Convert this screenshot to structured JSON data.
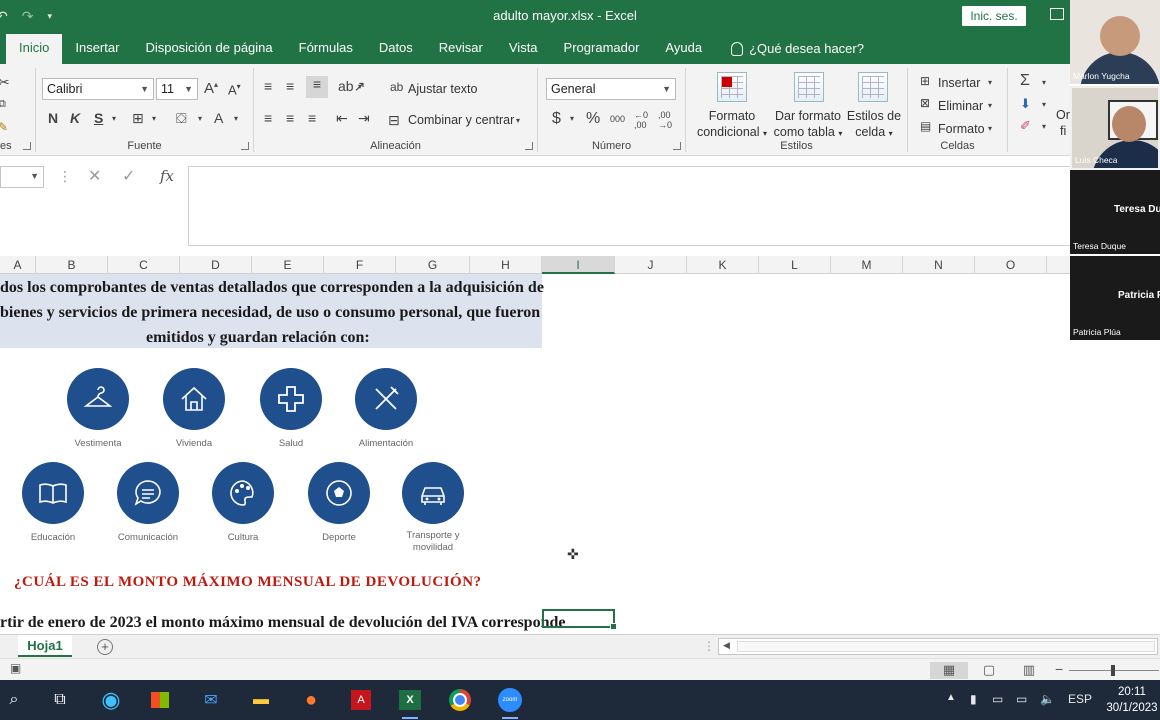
{
  "window": {
    "title": "adulto mayor.xlsx  -  Excel",
    "signin": "Inic. ses."
  },
  "tabs": [
    {
      "label": "Inicio",
      "active": true
    },
    {
      "label": "Insertar"
    },
    {
      "label": "Disposición de página"
    },
    {
      "label": "Fórmulas"
    },
    {
      "label": "Datos"
    },
    {
      "label": "Revisar"
    },
    {
      "label": "Vista"
    },
    {
      "label": "Programador"
    },
    {
      "label": "Ayuda"
    }
  ],
  "tellme": "¿Qué desea hacer?",
  "ribbon": {
    "font": {
      "name": "Calibri",
      "size": "11",
      "bold": "N",
      "italic": "K",
      "underline": "S",
      "group": "Fuente"
    },
    "alignment": {
      "wrap": "Ajustar texto",
      "merge": "Combinar y centrar",
      "group": "Alineación"
    },
    "number": {
      "format": "General",
      "currency": "$",
      "percent": "%",
      "thousands": "000",
      "inc_dec": ",0 ,00",
      "group": "Número"
    },
    "styles": {
      "conditional": [
        "Formato",
        "condicional"
      ],
      "table": [
        "Dar formato",
        "como tabla"
      ],
      "cell": [
        "Estilos de",
        "celda"
      ],
      "group": "Estilos"
    },
    "cells": {
      "insert": "Insertar",
      "delete": "Eliminar",
      "format": "Formato",
      "group": "Celdas"
    },
    "editing": {
      "sigma": "Σ",
      "sort_cut": "Or",
      "find_cut": "fi"
    },
    "left_cut": "es"
  },
  "formula_bar": {
    "fx": "fx",
    "cancel": "✕",
    "enter": "✓"
  },
  "columns": [
    "A",
    "B",
    "C",
    "D",
    "E",
    "F",
    "G",
    "H",
    "I",
    "J",
    "K",
    "L",
    "M",
    "N",
    "O"
  ],
  "selected_column": "I",
  "sheet": {
    "lines": [
      "dos los comprobantes de ventas detallados que corresponden a la adquisición de",
      "bienes y servicios de primera necesidad, de uso o consumo personal, que fueron",
      "emitidos y guardan relación con:"
    ],
    "categories_row1": [
      "Vestimenta",
      "Vivienda",
      "Salud",
      "Alimentación"
    ],
    "categories_row2": [
      "Educación",
      "Comunicación",
      "Cultura",
      "Deporte",
      "Transporte y movilidad"
    ],
    "question": "¿CUÁL ES EL MONTO MÁXIMO MENSUAL DE DEVOLUCIÓN?",
    "bottom_line": "rtir de enero de 2023 el monto máximo mensual de devolución del IVA corresponde"
  },
  "sheet_tab": "Hoja1",
  "taskbar": {
    "lang": "ESP",
    "time": "20:11",
    "date": "30/1/2023"
  },
  "participants": [
    {
      "name": "Marlon Yugcha",
      "video": true
    },
    {
      "name": "Luis Checa",
      "video": true
    },
    {
      "name": "Teresa Duque",
      "display": "Teresa Du"
    },
    {
      "name": "Patricia Plúa",
      "display": "Patricia P"
    }
  ],
  "colors": {
    "excel_green": "#217346",
    "icon_blue": "#1f4f8c",
    "question_red": "#c0180c",
    "taskbar": "#1e2a3a"
  }
}
